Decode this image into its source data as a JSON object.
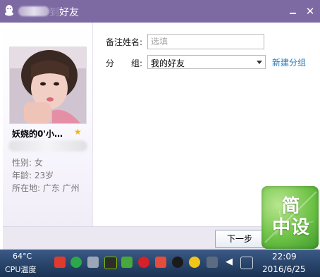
{
  "window": {
    "title": "好友",
    "title_ghost": "到",
    "close_glyph": "✕"
  },
  "profile": {
    "nickname": "妖娆的0'小…",
    "star_glyph": "★",
    "gender": "性别: 女",
    "age": "年龄: 23岁",
    "location": "所在地: 广东  广州"
  },
  "form": {
    "remark_label": "备注姓名:",
    "remark_placeholder": "选填",
    "remark_value": "",
    "group_label_1": "分",
    "group_label_2": "组:",
    "group_value": "我的好友",
    "new_group_link": "新建分组"
  },
  "footer": {
    "next_button": "下一步"
  },
  "watermark": {
    "line1": "简",
    "line2": "中设"
  },
  "taskbar": {
    "cpu_temp": "64°C",
    "cpu_label": "CPU温度",
    "time": "22:09",
    "date": "2016/6/25",
    "tray_icons": [
      "qq-music-icon",
      "wechat-icon",
      "network-user-icon",
      "nvidia-icon",
      "security-shield-icon",
      "netease-music-icon",
      "firewall-icon",
      "qq-penguin-icon",
      "add-user-icon",
      "bluetooth-icon",
      "volume-icon",
      "action-center-icon"
    ]
  }
}
